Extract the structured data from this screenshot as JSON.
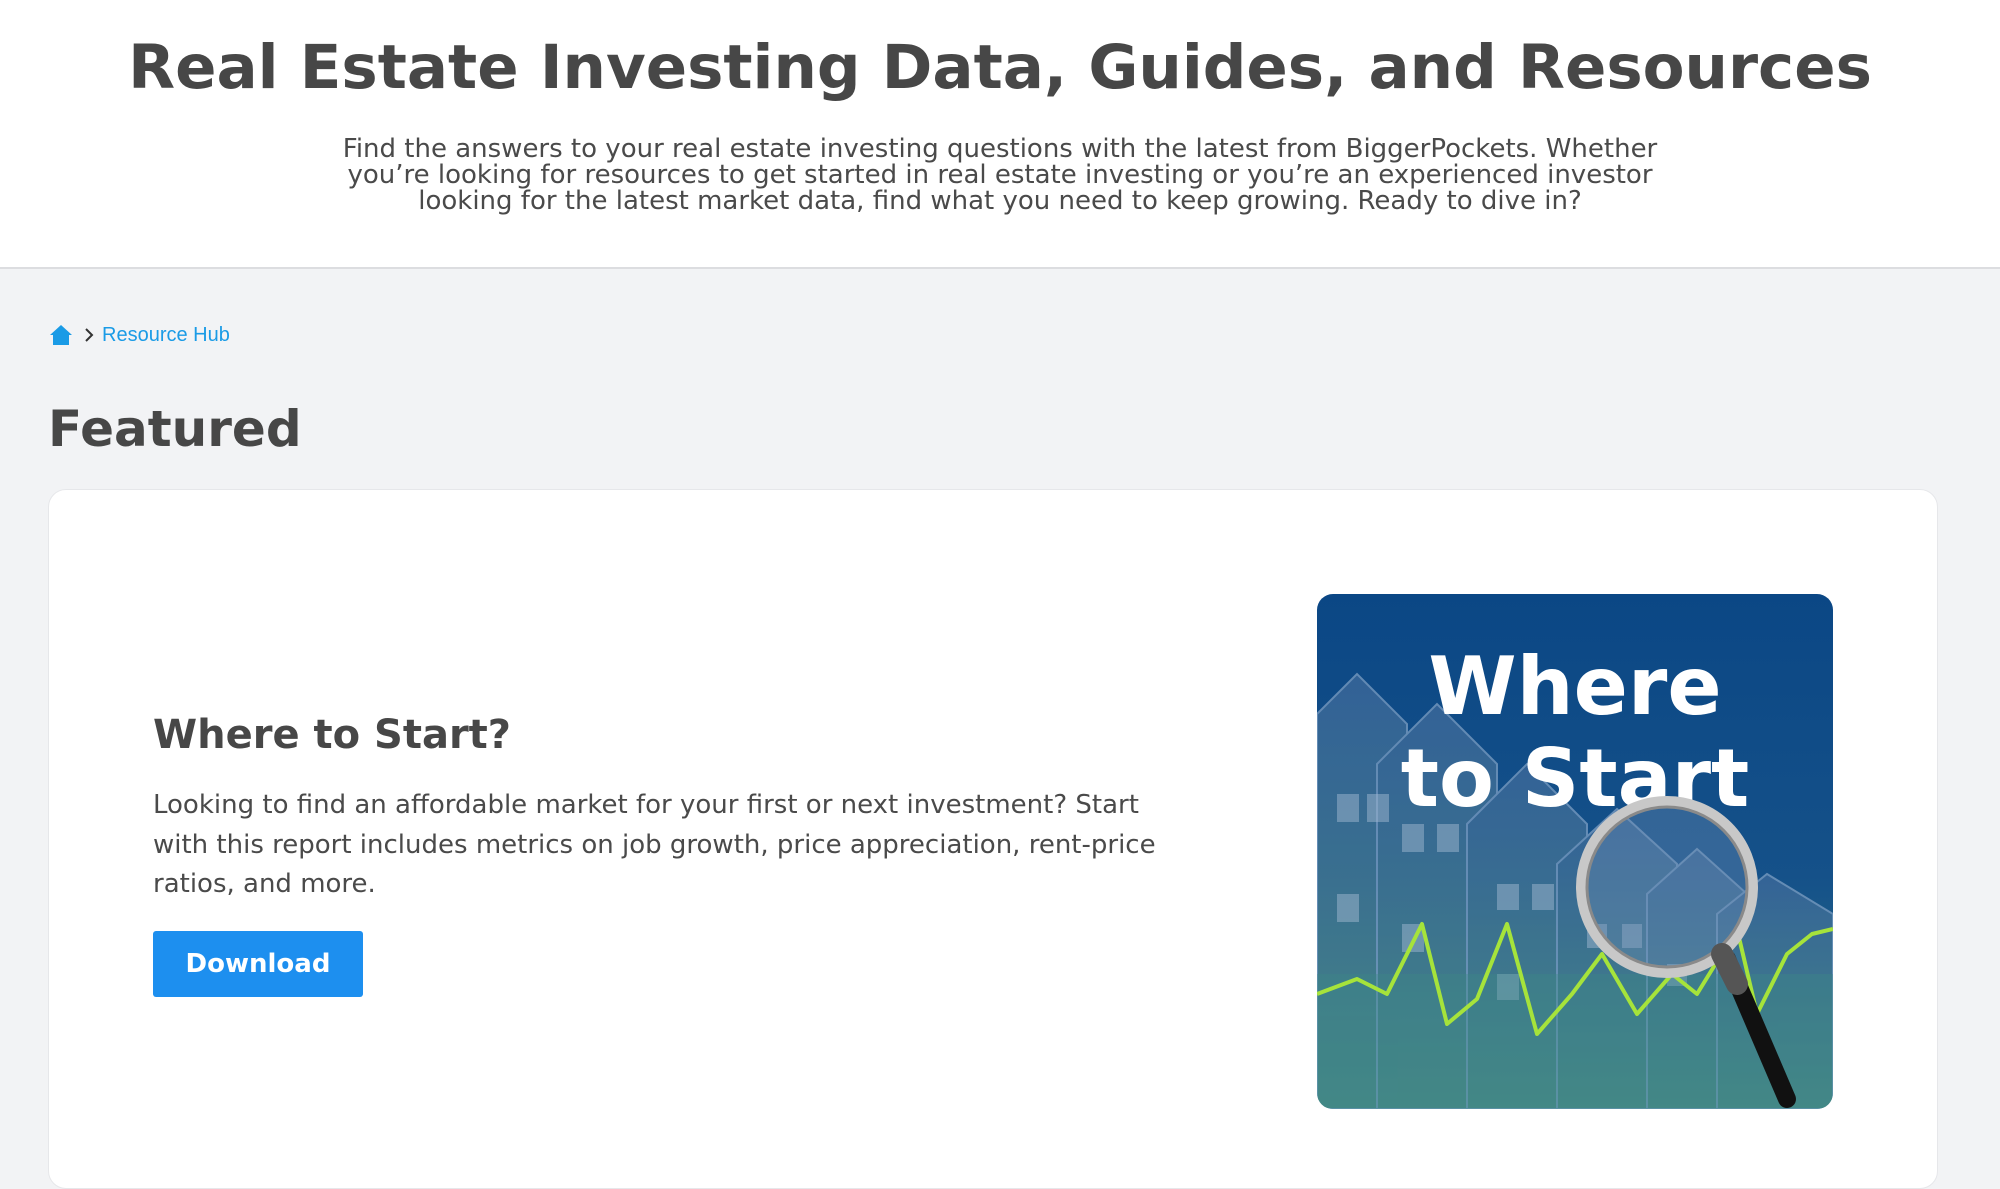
{
  "hero": {
    "title": "Real Estate Investing Data, Guides, and Resources",
    "subtitle": "Find the answers to your real estate investing questions with the latest from BiggerPockets. Whether you’re looking for resources to get started in real estate investing or you’re an experienced investor looking for the latest market data, find what you need to keep growing. Ready to dive in?"
  },
  "breadcrumb": {
    "home_icon": "home-icon",
    "separator_icon": "chevron-right-icon",
    "current": "Resource Hub"
  },
  "featured": {
    "heading": "Featured",
    "card": {
      "title": "Where to Start?",
      "description": "Looking to find an affordable market for your first or next investment? Start with this report includes metrics on job growth, price appreciation, rent-price ratios, and more.",
      "button_label": "Download",
      "image_text_line1": "Where",
      "image_text_line2": "to Start"
    }
  },
  "colors": {
    "accent": "#1d8fef",
    "link": "#1a9be6",
    "heading": "#474747",
    "background": "#f2f3f5",
    "image_bg": "#0d4a86",
    "chart_line": "#a6e33b"
  }
}
